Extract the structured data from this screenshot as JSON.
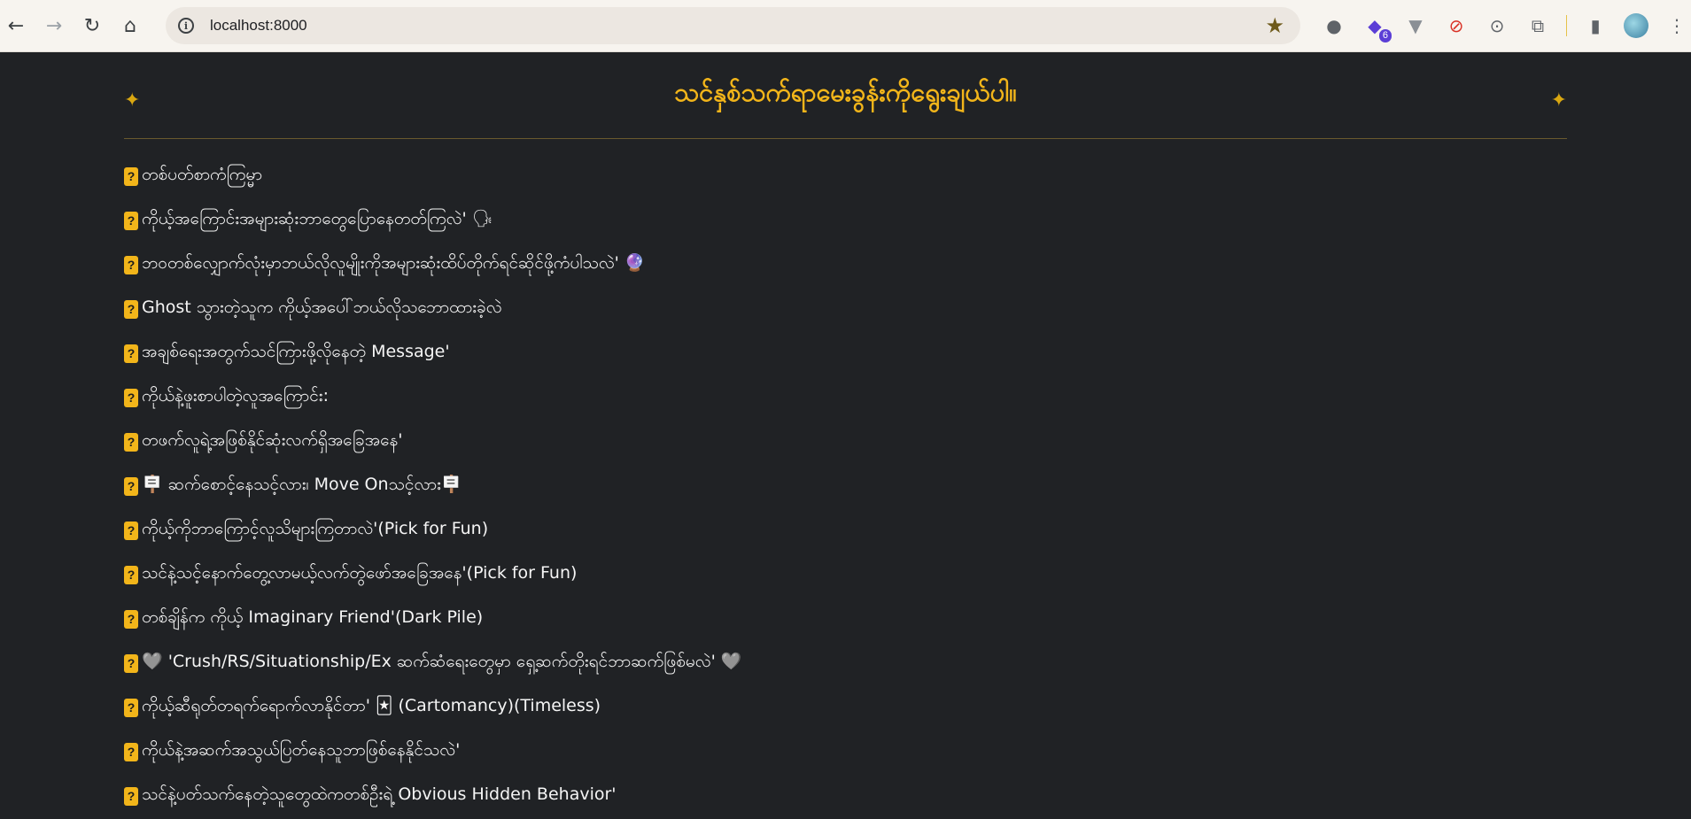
{
  "browser": {
    "url": "localhost:8000",
    "extension_badge": "6"
  },
  "page": {
    "title": "သင်နှစ်သက်ရာမေးခွန်းကိုရွေးချယ်ပါ။",
    "questions": [
      "တစ်ပတ်စာကံကြမ္မာ",
      "ကိုယ့်အကြောင်းအများဆုံးဘာတွေပြောနေတတ်ကြလဲ' 🗣",
      "ဘဝတစ်လျှောက်လုံးမှာဘယ်လိုလူမျိုးကိုအများဆုံးထိပ်တိုက်ရင်ဆိုင်ဖို့ကံပါသလဲ' 🔮",
      "Ghost သွားတဲ့သူက ကိုယ့်အပေါ်ဘယ်လိုသဘောထားခဲ့လဲ",
      "အချစ်ရေးအတွက်သင်ကြားဖို့လိုနေတဲ့ Message'",
      "ကိုယ်နဲ့ဖူးစာပါတဲ့လူအကြောင်း:",
      "တဖက်လူရဲ့အဖြစ်နိုင်ဆုံးလက်ရှိအခြေအနေ'",
      "🪧 ဆက်စောင့်နေသင့်လား၊ Move Onသင့်လား🪧",
      "ကိုယ့်ကိုဘာကြောင့်လူသိများကြတာလဲ'(Pick for Fun)",
      "သင်နဲ့သင့်နောက်တွေ့လာမယ့်လက်တွဲဖော်အခြေအနေ'(Pick for Fun)",
      "တစ်ချိန်က ကိုယ့် Imaginary Friend'(Dark Pile)",
      "🩶 'Crush/RS/Situationship/Ex ဆက်ဆံရေးတွေမှာ ရှေ့ဆက်တိုးရင်ဘာဆက်ဖြစ်မလဲ' 🩶",
      "ကိုယ့်ဆီရုတ်တရက်ရောက်လာနိုင်တာ' 🃏 (Cartomancy)(Timeless)",
      "ကိုယ်နဲ့အဆက်အသွယ်ပြတ်နေသူဘာဖြစ်နေနိုင်သလဲ'",
      "သင်နဲ့ပတ်သက်နေတဲ့သူတွေထဲကတစ်ဦးရဲ့ Obvious Hidden Behavior'"
    ]
  }
}
